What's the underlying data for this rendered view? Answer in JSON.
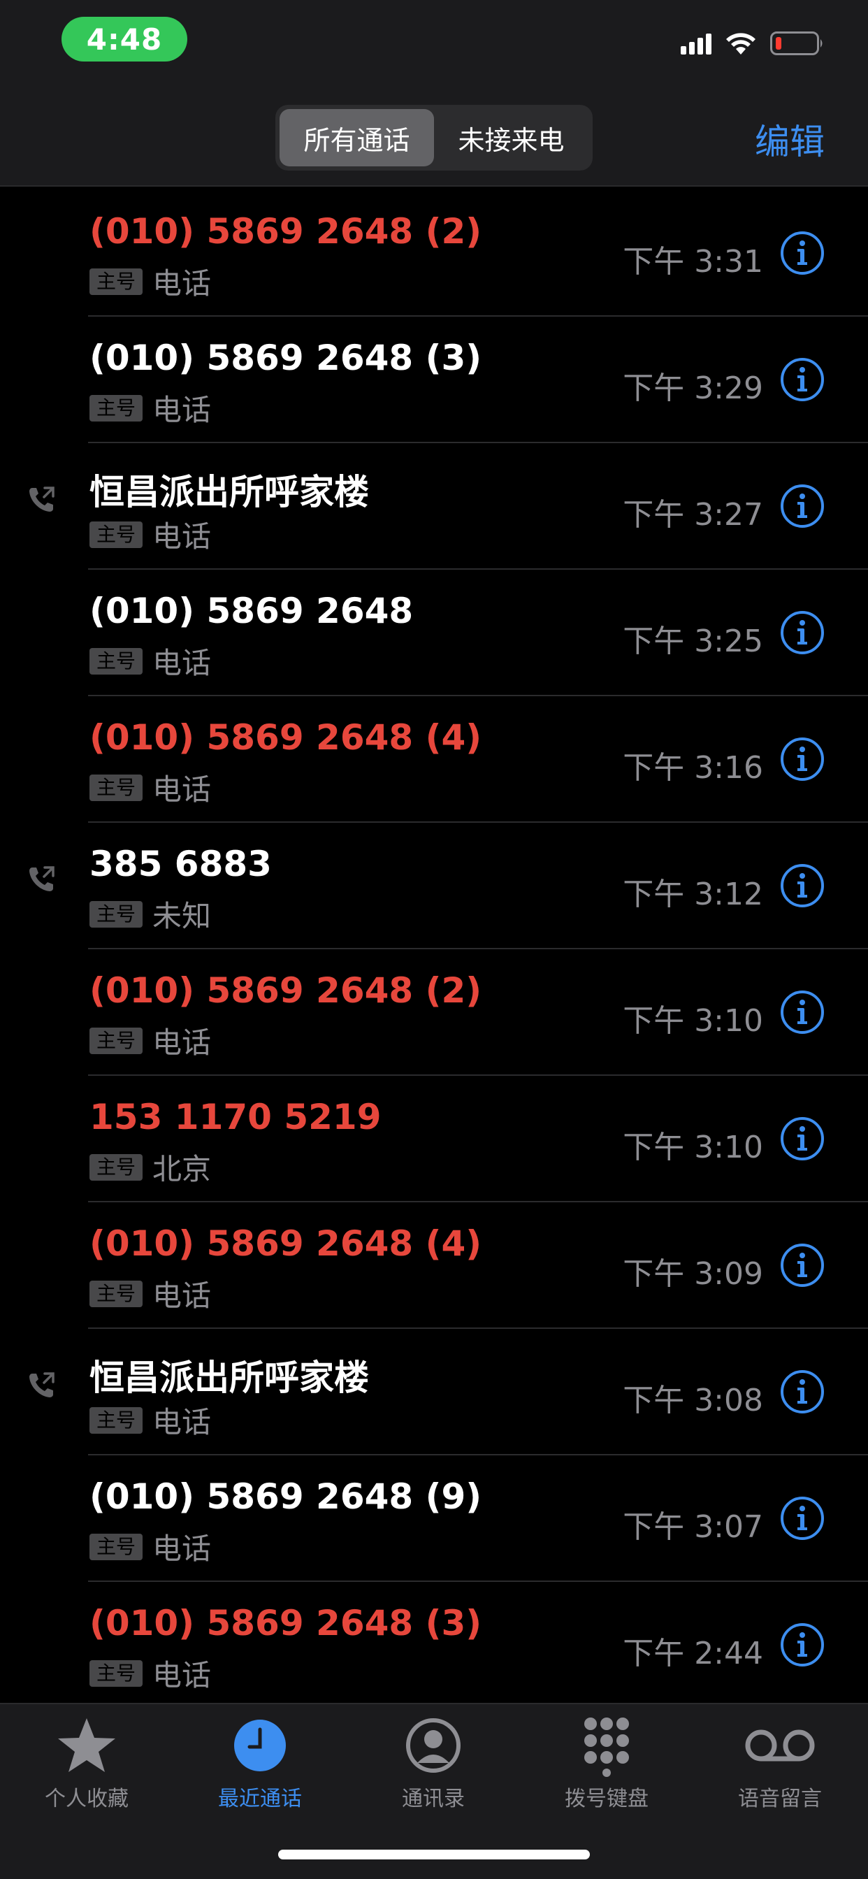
{
  "status_bar": {
    "time": "4:48"
  },
  "header": {
    "segments": [
      "所有通话",
      "未接来电"
    ],
    "active_segment": 0,
    "edit_label": "编辑"
  },
  "colors": {
    "missed": "#e7473c",
    "accent": "#3d8ef0",
    "time_pill": "#34c759"
  },
  "calls": [
    {
      "name": "(010) 5869 2648 (2)",
      "badge": "主号",
      "label": "电话",
      "time": "下午 3:31",
      "missed": true,
      "outgoing": false
    },
    {
      "name": "(010) 5869 2648 (3)",
      "badge": "主号",
      "label": "电话",
      "time": "下午 3:29",
      "missed": false,
      "outgoing": false
    },
    {
      "name": "恒昌派出所呼家楼",
      "badge": "主号",
      "label": "电话",
      "time": "下午 3:27",
      "missed": false,
      "outgoing": true
    },
    {
      "name": "(010) 5869 2648",
      "badge": "主号",
      "label": "电话",
      "time": "下午 3:25",
      "missed": false,
      "outgoing": false
    },
    {
      "name": "(010) 5869 2648 (4)",
      "badge": "主号",
      "label": "电话",
      "time": "下午 3:16",
      "missed": true,
      "outgoing": false
    },
    {
      "name": "385 6883",
      "badge": "主号",
      "label": "未知",
      "time": "下午 3:12",
      "missed": false,
      "outgoing": true
    },
    {
      "name": "(010) 5869 2648 (2)",
      "badge": "主号",
      "label": "电话",
      "time": "下午 3:10",
      "missed": true,
      "outgoing": false
    },
    {
      "name": "153 1170 5219",
      "badge": "主号",
      "label": "北京",
      "time": "下午 3:10",
      "missed": true,
      "outgoing": false
    },
    {
      "name": "(010) 5869 2648 (4)",
      "badge": "主号",
      "label": "电话",
      "time": "下午 3:09",
      "missed": true,
      "outgoing": false
    },
    {
      "name": "恒昌派出所呼家楼",
      "badge": "主号",
      "label": "电话",
      "time": "下午 3:08",
      "missed": false,
      "outgoing": true
    },
    {
      "name": "(010) 5869 2648 (9)",
      "badge": "主号",
      "label": "电话",
      "time": "下午 3:07",
      "missed": false,
      "outgoing": false
    },
    {
      "name": "(010) 5869 2648 (3)",
      "badge": "主号",
      "label": "电话",
      "time": "下午 2:44",
      "missed": true,
      "outgoing": false
    }
  ],
  "tabbar": {
    "items": [
      {
        "label": "个人收藏",
        "icon": "star-icon"
      },
      {
        "label": "最近通话",
        "icon": "clock-icon"
      },
      {
        "label": "通讯录",
        "icon": "contact-icon"
      },
      {
        "label": "拨号键盘",
        "icon": "keypad-icon"
      },
      {
        "label": "语音留言",
        "icon": "voicemail-icon"
      }
    ],
    "active": 1
  }
}
